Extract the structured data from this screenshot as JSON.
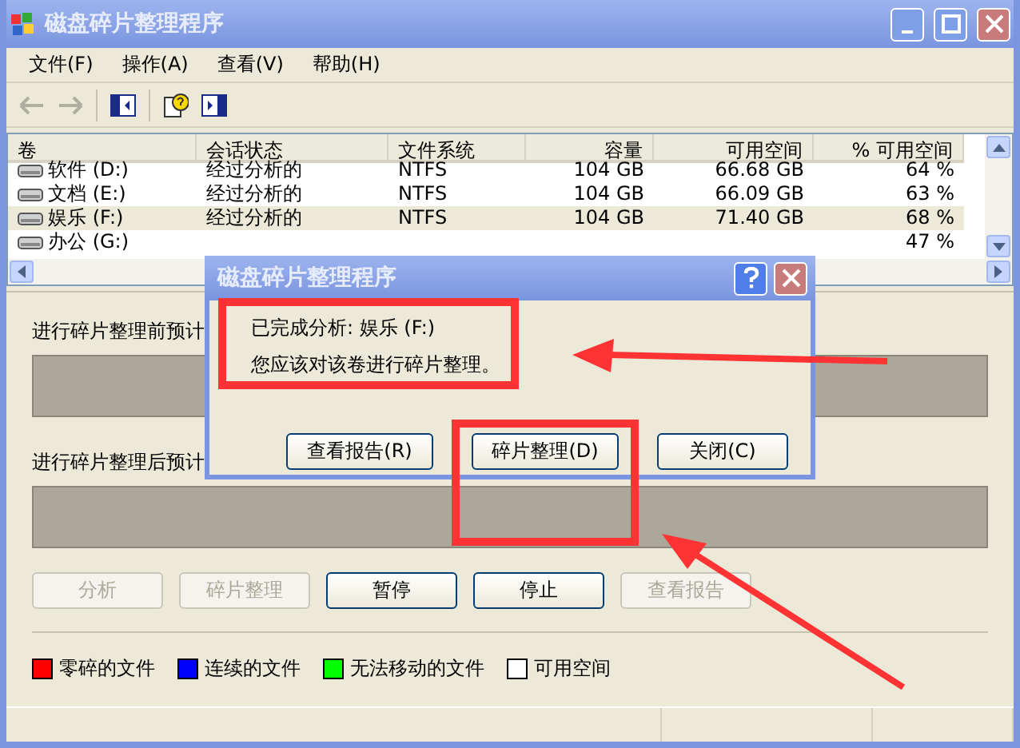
{
  "window": {
    "title": "磁盘碎片整理程序"
  },
  "menu": [
    {
      "label": "文件(F)"
    },
    {
      "label": "操作(A)"
    },
    {
      "label": "查看(V)"
    },
    {
      "label": "帮助(H)"
    }
  ],
  "volumes": {
    "columns": [
      "卷",
      "会话状态",
      "文件系统",
      "容量",
      "可用空间",
      "% 可用空间"
    ],
    "rows": [
      {
        "volume": "软件 (D:)",
        "status": "经过分析的",
        "fs": "NTFS",
        "capacity": "104 GB",
        "free": "66.68 GB",
        "pct": "64 %",
        "selected": false
      },
      {
        "volume": "文档 (E:)",
        "status": "经过分析的",
        "fs": "NTFS",
        "capacity": "104 GB",
        "free": "66.09 GB",
        "pct": "63 %",
        "selected": false
      },
      {
        "volume": "娱乐 (F:)",
        "status": "经过分析的",
        "fs": "NTFS",
        "capacity": "104 GB",
        "free": "71.40 GB",
        "pct": "68 %",
        "selected": true
      },
      {
        "volume": "办公 (G:)",
        "pct": "47 %",
        "selected": false
      }
    ]
  },
  "estimates": [
    {
      "label": "进行碎片整理前预计"
    },
    {
      "label": "进行碎片整理后预计"
    }
  ],
  "actions": [
    {
      "label": "分析",
      "disabled": true
    },
    {
      "label": "碎片整理",
      "disabled": true
    },
    {
      "label": "暂停",
      "disabled": false
    },
    {
      "label": "停止",
      "disabled": false
    },
    {
      "label": "查看报告",
      "disabled": true
    }
  ],
  "legend": [
    {
      "label": "零碎的文件",
      "color": "#ff0000"
    },
    {
      "label": "连续的文件",
      "color": "#0000ff"
    },
    {
      "label": "无法移动的文件",
      "color": "#00ff00"
    },
    {
      "label": "可用空间",
      "color": "#ffffff"
    }
  ],
  "dialog": {
    "title": "磁盘碎片整理程序",
    "lines": [
      "已完成分析: 娱乐 (F:)",
      "您应该对该卷进行碎片整理。"
    ],
    "buttons": [
      "查看报告(R)",
      "碎片整理(D)",
      "关闭(C)"
    ]
  }
}
